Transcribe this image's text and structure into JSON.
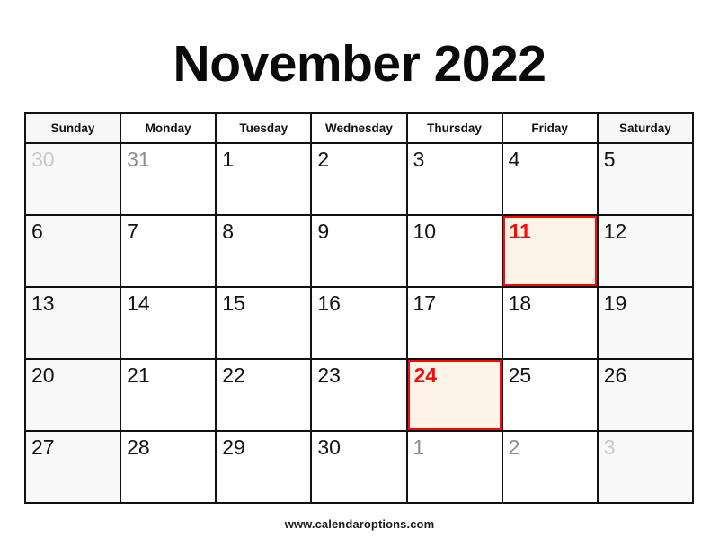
{
  "title": "November 2022",
  "weekdays": [
    {
      "label": "Sunday",
      "shaded": true
    },
    {
      "label": "Monday",
      "shaded": false
    },
    {
      "label": "Tuesday",
      "shaded": false
    },
    {
      "label": "Wednesday",
      "shaded": false
    },
    {
      "label": "Thursday",
      "shaded": false
    },
    {
      "label": "Friday",
      "shaded": false
    },
    {
      "label": "Saturday",
      "shaded": true
    }
  ],
  "colors": {
    "grid_line": "#111111",
    "weekend_shade": "#f8f8f8",
    "text": "#121212",
    "muted": "#8d8d8d",
    "muted_soft": "#cacaca",
    "highlight_border": "#fa0a0a",
    "highlight_fill": "#fdf3e8",
    "highlight_text": "#fa0a0a"
  },
  "weeks": [
    [
      {
        "day": "30",
        "style": "muted-soft",
        "shaded": true,
        "highlight": false
      },
      {
        "day": "31",
        "style": "muted",
        "shaded": false,
        "highlight": false
      },
      {
        "day": "1",
        "style": "normal",
        "shaded": false,
        "highlight": false
      },
      {
        "day": "2",
        "style": "normal",
        "shaded": false,
        "highlight": false
      },
      {
        "day": "3",
        "style": "normal",
        "shaded": false,
        "highlight": false
      },
      {
        "day": "4",
        "style": "normal",
        "shaded": false,
        "highlight": false
      },
      {
        "day": "5",
        "style": "normal",
        "shaded": true,
        "highlight": false
      }
    ],
    [
      {
        "day": "6",
        "style": "normal",
        "shaded": true,
        "highlight": false
      },
      {
        "day": "7",
        "style": "normal",
        "shaded": false,
        "highlight": false
      },
      {
        "day": "8",
        "style": "normal",
        "shaded": false,
        "highlight": false
      },
      {
        "day": "9",
        "style": "normal",
        "shaded": false,
        "highlight": false
      },
      {
        "day": "10",
        "style": "normal",
        "shaded": false,
        "highlight": false
      },
      {
        "day": "11",
        "style": "normal",
        "shaded": false,
        "highlight": true
      },
      {
        "day": "12",
        "style": "normal",
        "shaded": true,
        "highlight": false
      }
    ],
    [
      {
        "day": "13",
        "style": "normal",
        "shaded": true,
        "highlight": false
      },
      {
        "day": "14",
        "style": "normal",
        "shaded": false,
        "highlight": false
      },
      {
        "day": "15",
        "style": "normal",
        "shaded": false,
        "highlight": false
      },
      {
        "day": "16",
        "style": "normal",
        "shaded": false,
        "highlight": false
      },
      {
        "day": "17",
        "style": "normal",
        "shaded": false,
        "highlight": false
      },
      {
        "day": "18",
        "style": "normal",
        "shaded": false,
        "highlight": false
      },
      {
        "day": "19",
        "style": "normal",
        "shaded": true,
        "highlight": false
      }
    ],
    [
      {
        "day": "20",
        "style": "normal",
        "shaded": true,
        "highlight": false
      },
      {
        "day": "21",
        "style": "normal",
        "shaded": false,
        "highlight": false
      },
      {
        "day": "22",
        "style": "normal",
        "shaded": false,
        "highlight": false
      },
      {
        "day": "23",
        "style": "normal",
        "shaded": false,
        "highlight": false
      },
      {
        "day": "24",
        "style": "normal",
        "shaded": false,
        "highlight": true
      },
      {
        "day": "25",
        "style": "normal",
        "shaded": false,
        "highlight": false
      },
      {
        "day": "26",
        "style": "normal",
        "shaded": true,
        "highlight": false
      }
    ],
    [
      {
        "day": "27",
        "style": "normal",
        "shaded": true,
        "highlight": false
      },
      {
        "day": "28",
        "style": "normal",
        "shaded": false,
        "highlight": false
      },
      {
        "day": "29",
        "style": "normal",
        "shaded": false,
        "highlight": false
      },
      {
        "day": "30",
        "style": "normal",
        "shaded": false,
        "highlight": false
      },
      {
        "day": "1",
        "style": "muted",
        "shaded": false,
        "highlight": false
      },
      {
        "day": "2",
        "style": "muted",
        "shaded": false,
        "highlight": false
      },
      {
        "day": "3",
        "style": "muted-soft",
        "shaded": true,
        "highlight": false
      }
    ]
  ],
  "footer": "www.calendaroptions.com"
}
